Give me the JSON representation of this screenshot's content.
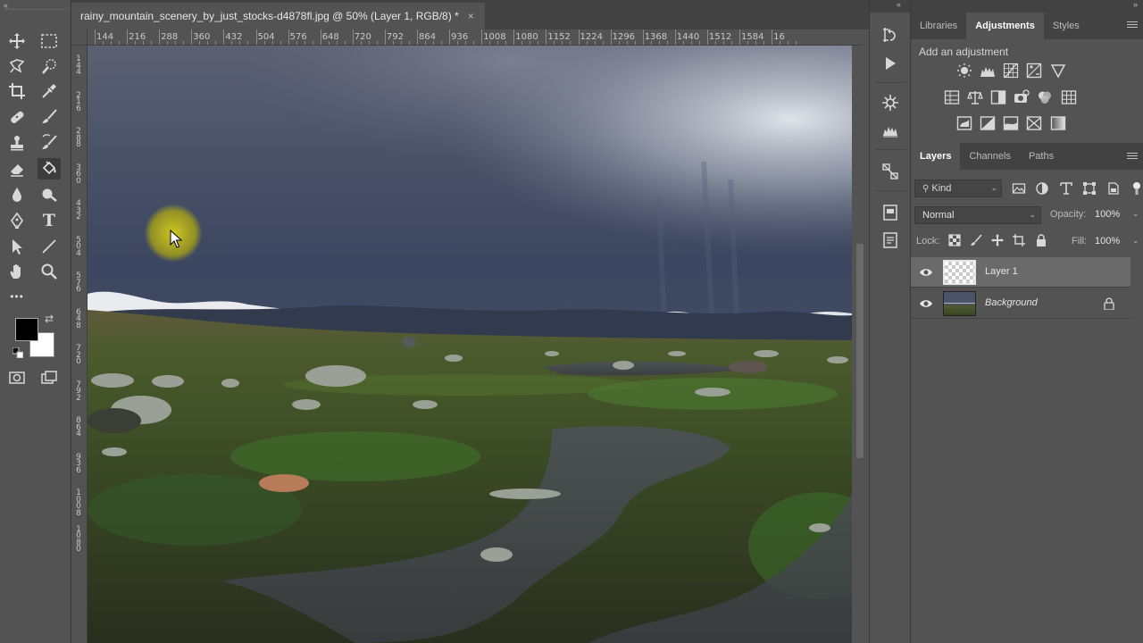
{
  "app": {
    "document_tab": "rainy_mountain_scenery_by_just_stocks-d4878fl.jpg @ 50% (Layer 1, RGB/8) *",
    "tab_close": "×",
    "collapse_left": "«",
    "collapse_right": "«",
    "collapse_dock": "»"
  },
  "colors": {
    "accent_cursor_highlight": "#e1d70f",
    "foreground": "#000000",
    "background": "#ffffff"
  },
  "toolbar": {
    "tools": [
      {
        "name": "move-tool",
        "icon": "move-icon"
      },
      {
        "name": "marquee-tool",
        "icon": "rect-marquee-icon"
      },
      {
        "name": "lasso-tool",
        "icon": "lasso-icon"
      },
      {
        "name": "quick-select-tool",
        "icon": "quick-select-icon"
      },
      {
        "name": "crop-tool",
        "icon": "crop-icon"
      },
      {
        "name": "eyedropper-tool",
        "icon": "eyedropper-icon"
      },
      {
        "name": "healing-tool",
        "icon": "bandage-icon"
      },
      {
        "name": "brush-tool",
        "icon": "brush-icon"
      },
      {
        "name": "stamp-tool",
        "icon": "stamp-icon"
      },
      {
        "name": "history-brush-tool",
        "icon": "history-brush-icon"
      },
      {
        "name": "eraser-tool",
        "icon": "eraser-icon"
      },
      {
        "name": "paint-bucket-tool",
        "icon": "paint-bucket-icon"
      },
      {
        "name": "blur-tool",
        "icon": "drop-icon"
      },
      {
        "name": "dodge-tool",
        "icon": "dodge-icon"
      },
      {
        "name": "pen-tool",
        "icon": "pen-icon"
      },
      {
        "name": "type-tool",
        "icon": "type-icon"
      },
      {
        "name": "path-select-tool",
        "icon": "arrow-icon"
      },
      {
        "name": "line-tool",
        "icon": "line-icon"
      },
      {
        "name": "hand-tool",
        "icon": "hand-icon"
      },
      {
        "name": "zoom-tool",
        "icon": "zoom-icon"
      }
    ],
    "more": "•••",
    "type_glyph": "T"
  },
  "rulers": {
    "horizontal": [
      "144",
      "216",
      "288",
      "360",
      "432",
      "504",
      "576",
      "648",
      "720",
      "792",
      "864",
      "936",
      "1008",
      "1080",
      "1152",
      "1224",
      "1296",
      "1368",
      "1440",
      "1512",
      "1584",
      "16"
    ],
    "vertical": [
      "144",
      "216",
      "288",
      "360",
      "432",
      "504",
      "576",
      "648",
      "720",
      "792",
      "864",
      "936",
      "1008",
      "1080"
    ]
  },
  "dock": {
    "icons": [
      "history-icon",
      "actions-play-icon",
      "properties-icon",
      "levels-icon",
      "paths-icon",
      "libraries-icon",
      "notes-icon"
    ]
  },
  "adjustments_panel": {
    "tabs": [
      {
        "label": "Libraries",
        "active": false
      },
      {
        "label": "Adjustments",
        "active": true
      },
      {
        "label": "Styles",
        "active": false
      }
    ],
    "title": "Add an adjustment",
    "row1": [
      "brightness-contrast-icon",
      "levels-icon",
      "curves-icon",
      "exposure-icon",
      "vibrance-icon"
    ],
    "row2": [
      "hue-saturation-icon",
      "color-balance-icon",
      "black-white-icon",
      "photo-filter-icon",
      "channel-mixer-icon",
      "color-lookup-icon"
    ],
    "row3": [
      "invert-icon",
      "posterize-icon",
      "threshold-icon",
      "selective-color-icon",
      "gradient-map-icon"
    ]
  },
  "layers_panel": {
    "tabs": [
      {
        "label": "Layers",
        "active": true
      },
      {
        "label": "Channels",
        "active": false
      },
      {
        "label": "Paths",
        "active": false
      }
    ],
    "kind_filter": "Kind",
    "blend_mode": "Normal",
    "opacity_label": "Opacity:",
    "opacity_value": "100%",
    "lock_label": "Lock:",
    "fill_label": "Fill:",
    "fill_value": "100%",
    "layers": [
      {
        "name": "Layer 1",
        "selected": true,
        "visible": true,
        "locked": false
      },
      {
        "name": "Background",
        "selected": false,
        "visible": true,
        "locked": true
      }
    ]
  }
}
